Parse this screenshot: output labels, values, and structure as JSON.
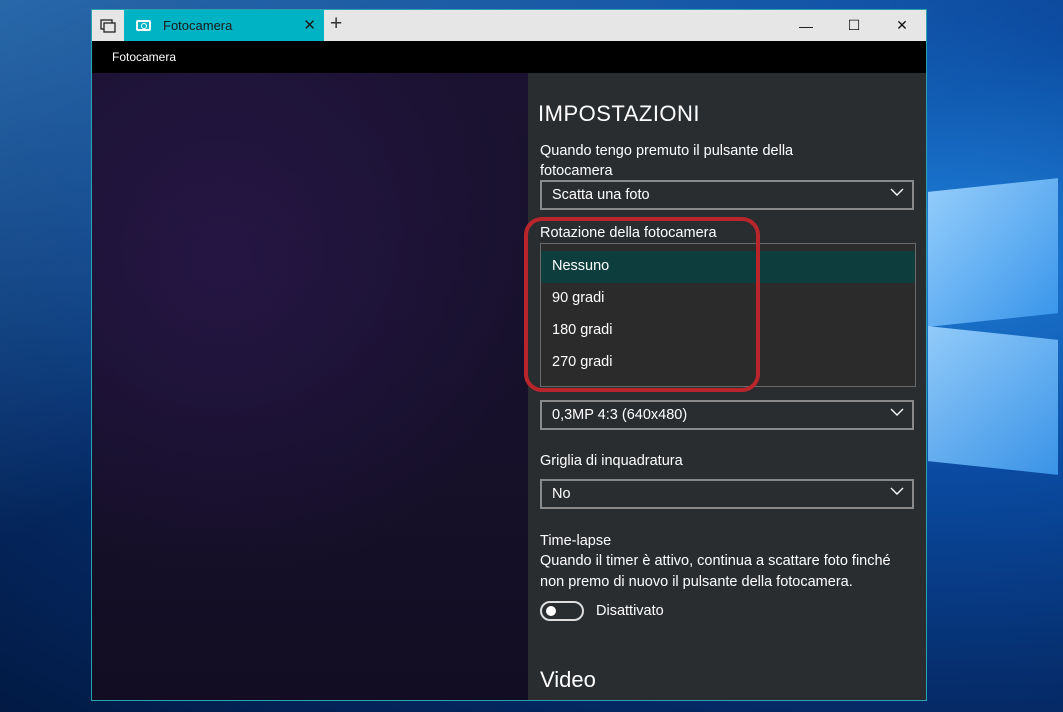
{
  "window": {
    "tab_title": "Fotocamera",
    "app_title": "Fotocamera",
    "new_tab_glyph": "+",
    "tab_close_glyph": "✕",
    "minimize_glyph": "—",
    "maximize_glyph": "☐",
    "close_glyph": "✕"
  },
  "settings": {
    "title": "IMPOSTAZIONI",
    "hold_button_label_line1": "Quando tengo premuto il pulsante della",
    "hold_button_label_line2": "fotocamera",
    "hold_button_value": "Scatta una foto",
    "rotation_label": "Rotazione della fotocamera",
    "rotation_options": [
      "Nessuno",
      "90 gradi",
      "180 gradi",
      "270 gradi"
    ],
    "rotation_selected": "Nessuno",
    "resolution_value": "0,3MP 4:3 (640x480)",
    "grid_label": "Griglia di inquadratura",
    "grid_value": "No",
    "timelapse_label": "Time-lapse",
    "timelapse_desc_line1": "Quando il timer è attivo, continua a scattare foto finché",
    "timelapse_desc_line2": "non premo di nuovo il pulsante della fotocamera.",
    "timelapse_state": "Disattivato",
    "video_heading": "Video"
  },
  "colors": {
    "tab_accent": "#00b3c4",
    "highlight_ring": "#b8262b",
    "selected_option": "#0d3e3d"
  }
}
